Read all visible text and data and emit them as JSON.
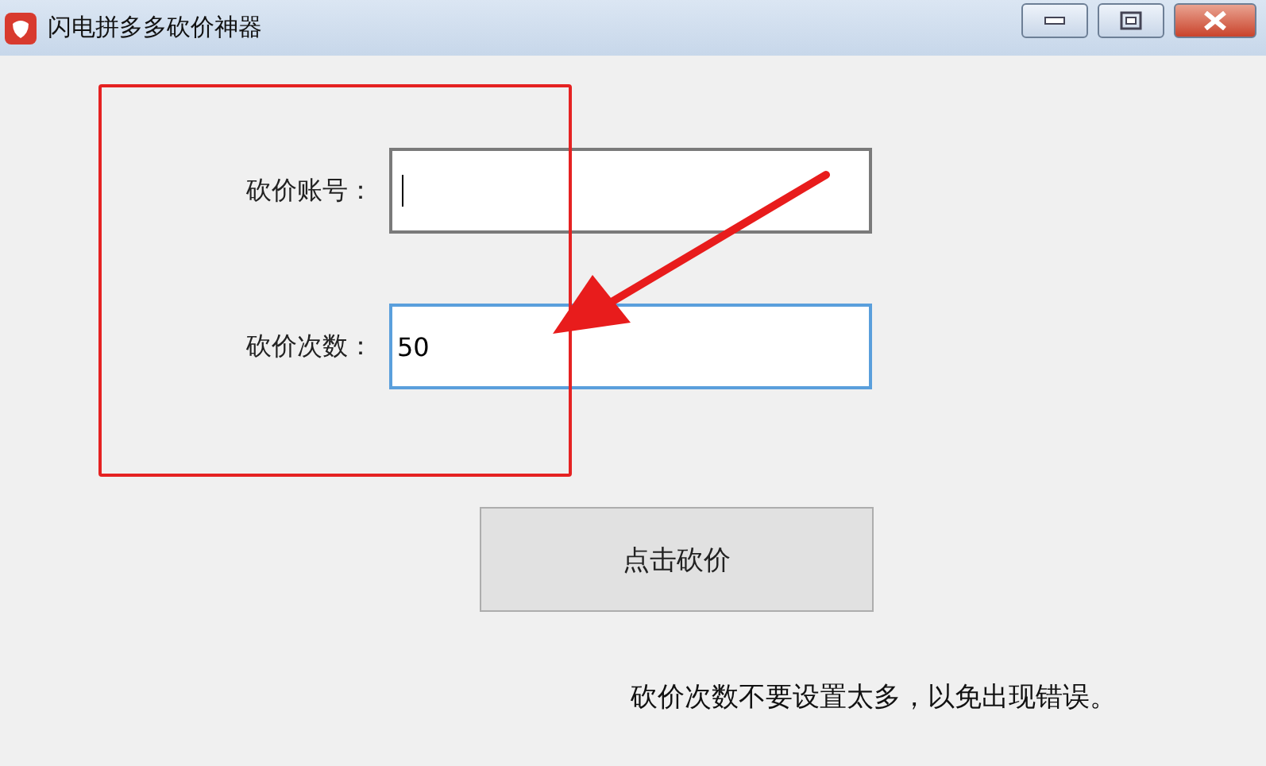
{
  "window": {
    "title": "闪电拼多多砍价神器"
  },
  "fields": [
    {
      "label": "砍价账号：",
      "focused": false
    },
    {
      "label": "砍价次数：",
      "value": "50",
      "focused": true
    }
  ],
  "button": {
    "label": "点击砍价"
  },
  "note": "砍价次数不要设置太多，以免出现错误。"
}
